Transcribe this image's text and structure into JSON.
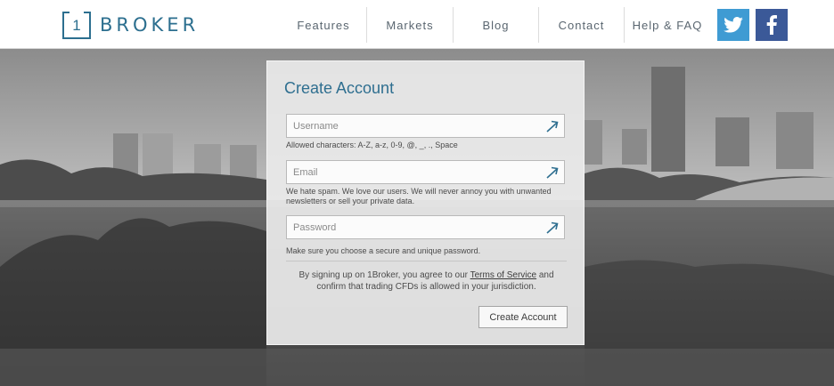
{
  "brand": {
    "number": "1",
    "name": "BROKER"
  },
  "nav": {
    "items": [
      "Features",
      "Markets",
      "Blog",
      "Contact",
      "Help & FAQ"
    ]
  },
  "social": {
    "twitter_icon": "twitter-icon",
    "facebook_icon": "facebook-icon"
  },
  "colors": {
    "brand": "#2c6f8f",
    "twitter": "#3f9bd3",
    "facebook": "#3b5998",
    "panel": "#eaeaea"
  },
  "form": {
    "title": "Create Account",
    "username": {
      "placeholder": "Username",
      "value": "",
      "hint": "Allowed characters: A-Z, a-z, 0-9, @, _, ., Space"
    },
    "email": {
      "placeholder": "Email",
      "value": "",
      "hint": "We hate spam. We love our users. We will never annoy you with unwanted newsletters or sell your private data."
    },
    "password": {
      "placeholder": "Password",
      "value": "",
      "hint": "Make sure you choose a secure and unique password."
    },
    "field_icon": "arrow-icon",
    "terms_before": "By signing up on 1Broker, you agree to our ",
    "terms_link": "Terms of Service",
    "terms_after": " and confirm that trading CFDs is allowed in your jurisdiction.",
    "submit_label": "Create Account"
  }
}
